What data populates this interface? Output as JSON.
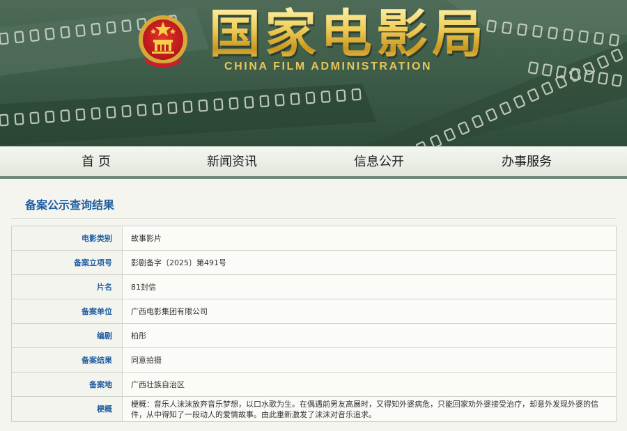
{
  "header": {
    "title_cn": "国家电影局",
    "title_en": "CHINA FILM ADMINISTRATION",
    "emblem": "national-emblem-icon"
  },
  "nav": {
    "items": [
      {
        "label": "首 页"
      },
      {
        "label": "新闻资讯"
      },
      {
        "label": "信息公开"
      },
      {
        "label": "办事服务"
      }
    ]
  },
  "main": {
    "section_title": "备案公示查询结果",
    "rows": [
      {
        "label": "电影类别",
        "value": "故事影片"
      },
      {
        "label": "备案立项号",
        "value": "影剧备字〔2025〕第491号"
      },
      {
        "label": "片名",
        "value": "81封信"
      },
      {
        "label": "备案单位",
        "value": "广西电影集团有限公司"
      },
      {
        "label": "编剧",
        "value": "柏彤"
      },
      {
        "label": "备案结果",
        "value": "同意拍摄"
      },
      {
        "label": "备案地",
        "value": "广西壮族自治区"
      },
      {
        "label": "梗概",
        "value": "梗概：音乐人沫沫放弃音乐梦想，以口水歌为生。在偶遇前男友高展时，又得知外婆病危，只能回家劝外婆接受治疗，却意外发现外婆的信件，从中得知了一段动人的爱情故事。由此重新激发了沫沫对音乐追求。"
      }
    ]
  },
  "colors": {
    "banner": "#3f5e4a",
    "gold": "#e5c04f",
    "label_blue": "#1f5ea3",
    "nav_strip": "#6f8a7a"
  }
}
